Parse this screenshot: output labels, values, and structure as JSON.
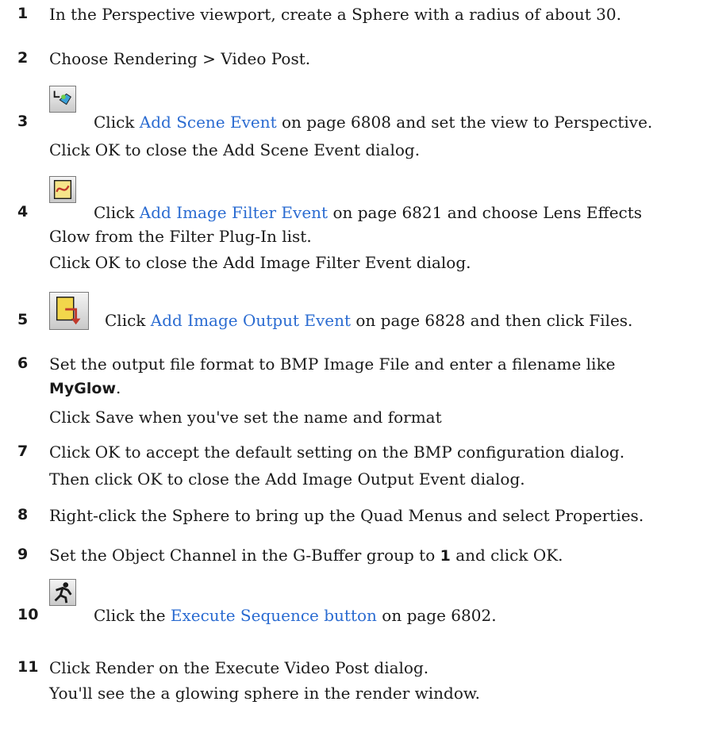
{
  "steps": [
    {
      "num": "1",
      "text": "In the Perspective viewport, create a Sphere with a radius of about 30."
    },
    {
      "num": "2",
      "text": "Choose Rendering > Video Post."
    },
    {
      "num": "3",
      "pre": "Click ",
      "link": "Add Scene Event",
      "post": " on page 6808 and set the view to Perspective.",
      "extra": "Click OK to close the Add Scene Event dialog.",
      "icon": "add-scene-event-icon"
    },
    {
      "num": "4",
      "pre": "Click ",
      "link": "Add Image Filter Event",
      "post": " on page 6821 and choose Lens Effects",
      "line2": "Glow from the Filter Plug-In list.",
      "extra": "Click OK to close the Add Image Filter Event dialog.",
      "icon": "add-image-filter-event-icon"
    },
    {
      "num": "5",
      "pre": "Click ",
      "link": "Add Image Output Event",
      "post": " on page 6828 and then click Files.",
      "icon": "add-image-output-event-icon"
    },
    {
      "num": "6",
      "text": "Set the output file format to BMP Image File and enter a filename like",
      "bold": "MyGlow",
      "boldpost": ".",
      "extra": "Click Save when you've set the name and format"
    },
    {
      "num": "7",
      "text": "Click OK to accept the default setting on the BMP configuration dialog.",
      "extra": "Then click OK to close the Add Image Output Event dialog."
    },
    {
      "num": "8",
      "text": "Right-click the Sphere to bring up the Quad Menus and select Properties."
    },
    {
      "num": "9",
      "pre": "Set the Object Channel in the G-Buffer group to ",
      "bold": "1",
      "post": " and click OK."
    },
    {
      "num": "10",
      "pre": "Click the ",
      "link": "Execute Sequence button",
      "post": " on page 6802.",
      "icon": "execute-sequence-icon"
    },
    {
      "num": "11",
      "text": "Click Render on the Execute Video Post dialog.",
      "extra": "You'll see the a glowing sphere in the render window."
    }
  ]
}
